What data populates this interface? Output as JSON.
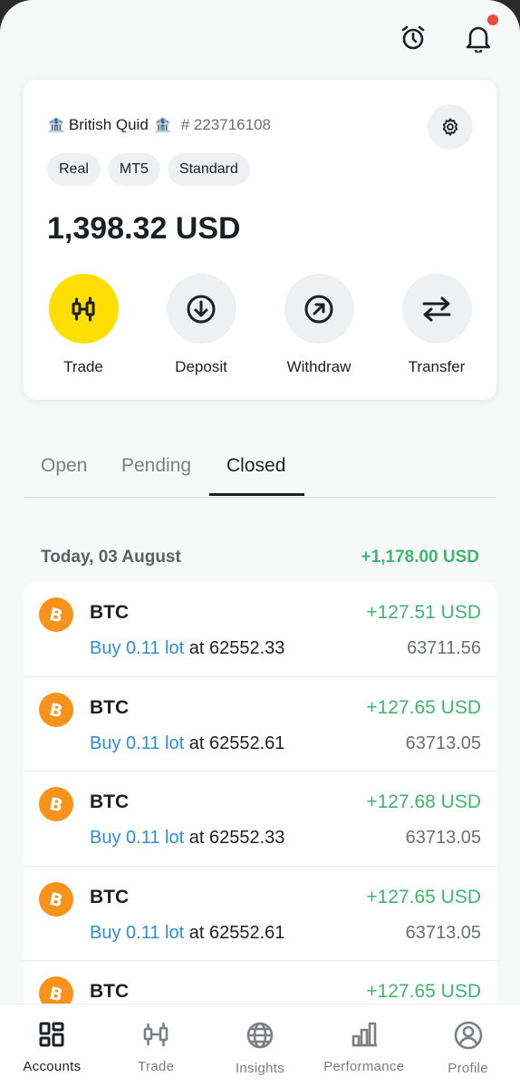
{
  "header": {
    "alarm_icon": "alarm-clock-icon",
    "bell_icon": "bell-icon",
    "has_notification": true
  },
  "account": {
    "bank_emoji": "🏦",
    "name": "British Quid",
    "number": "# 223716108",
    "chips": [
      "Real",
      "MT5",
      "Standard"
    ],
    "balance": "1,398.32 USD",
    "actions": [
      {
        "label": "Trade",
        "icon": "candlestick-icon"
      },
      {
        "label": "Deposit",
        "icon": "arrow-down-circle-icon"
      },
      {
        "label": "Withdraw",
        "icon": "arrow-up-right-circle-icon"
      },
      {
        "label": "Transfer",
        "icon": "swap-arrows-icon"
      }
    ]
  },
  "tabs": [
    "Open",
    "Pending",
    "Closed"
  ],
  "active_tab": "Closed",
  "day": {
    "title": "Today, 03 August",
    "total": "+1,178.00 USD"
  },
  "trades": [
    {
      "symbol": "BTC",
      "pnl": "+127.51 USD",
      "side_lot": "Buy 0.11 lot",
      "at": "at",
      "open_price": "62552.33",
      "close_price": "63711.56"
    },
    {
      "symbol": "BTC",
      "pnl": "+127.65 USD",
      "side_lot": "Buy 0.11 lot",
      "at": "at",
      "open_price": "62552.61",
      "close_price": "63713.05"
    },
    {
      "symbol": "BTC",
      "pnl": "+127.68 USD",
      "side_lot": "Buy 0.11 lot",
      "at": "at",
      "open_price": "62552.33",
      "close_price": "63713.05"
    },
    {
      "symbol": "BTC",
      "pnl": "+127.65 USD",
      "side_lot": "Buy 0.11 lot",
      "at": "at",
      "open_price": "62552.61",
      "close_price": "63713.05"
    },
    {
      "symbol": "BTC",
      "pnl": "+127.65 USD",
      "side_lot": "",
      "at": "",
      "open_price": "",
      "close_price": ""
    }
  ],
  "bottom_nav": [
    {
      "label": "Accounts",
      "icon": "grid-icon",
      "active": true
    },
    {
      "label": "Trade",
      "icon": "candlestick-icon",
      "active": false
    },
    {
      "label": "Insights",
      "icon": "globe-icon",
      "active": false
    },
    {
      "label": "Performance",
      "icon": "bar-chart-icon",
      "active": false
    },
    {
      "label": "Profile",
      "icon": "user-circle-icon",
      "active": false
    }
  ],
  "colors": {
    "accent_yellow": "#ffde02",
    "profit_green": "#3fb66d",
    "link_blue": "#2d8ed8",
    "bitcoin_orange": "#f7931a"
  }
}
